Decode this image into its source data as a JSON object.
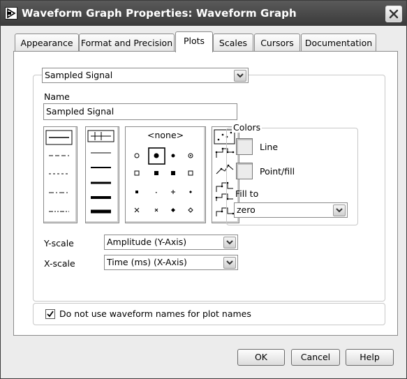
{
  "window": {
    "title": "Waveform Graph Properties: Waveform Graph"
  },
  "tabs": [
    {
      "label": "Appearance"
    },
    {
      "label": "Format and Precision"
    },
    {
      "label": "Plots"
    },
    {
      "label": "Scales"
    },
    {
      "label": "Cursors"
    },
    {
      "label": "Documentation"
    }
  ],
  "active_tab": "Plots",
  "plot_select": {
    "value": "Sampled Signal"
  },
  "name": {
    "label": "Name",
    "value": "Sampled Signal"
  },
  "point_styles": {
    "none_label": "<none>"
  },
  "colors": {
    "title": "Colors",
    "line_label": "Line",
    "point_fill_label": "Point/fill",
    "fill_to_label": "Fill to",
    "fill_to_value": "zero"
  },
  "scales": {
    "y_label": "Y-scale",
    "y_value": "Amplitude (Y-Axis)",
    "x_label": "X-scale",
    "x_value": "Time (ms) (X-Axis)"
  },
  "options": {
    "waveform_names_label": "Do not use waveform names for plot names",
    "waveform_names_checked": true
  },
  "buttons": {
    "ok": "OK",
    "cancel": "Cancel",
    "help": "Help"
  }
}
